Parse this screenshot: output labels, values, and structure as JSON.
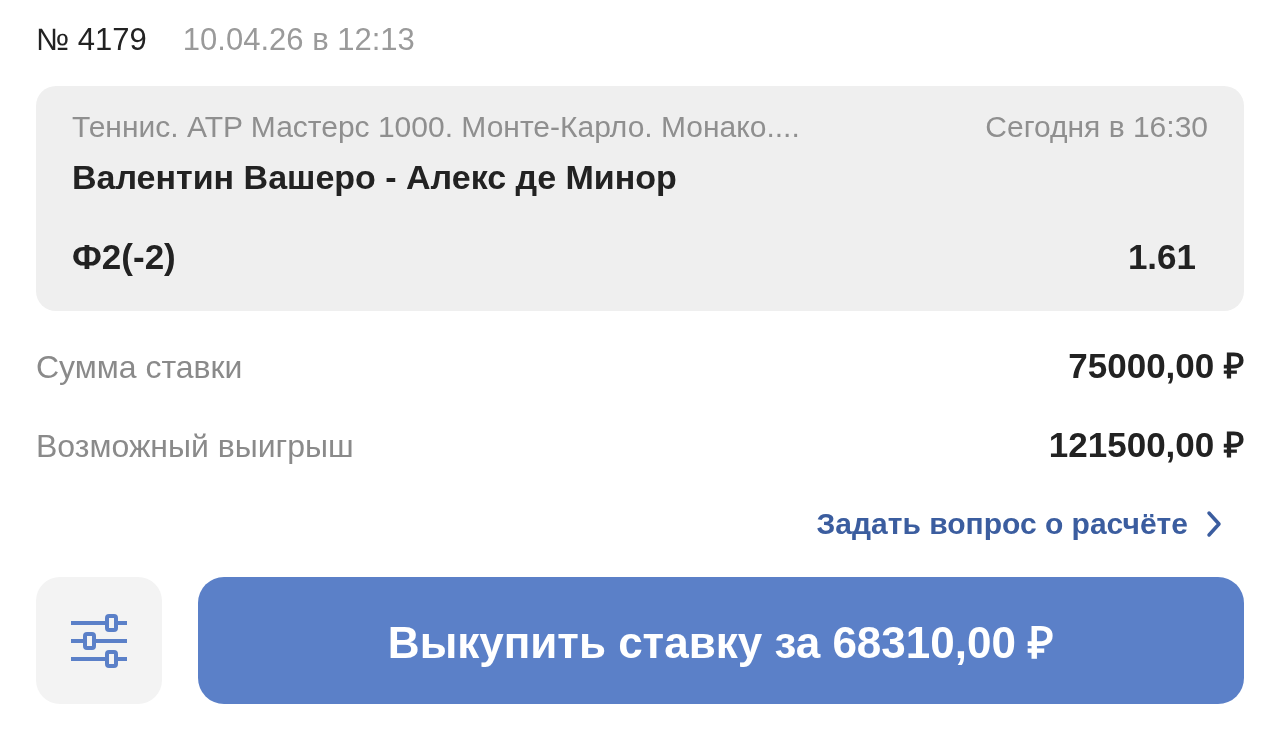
{
  "bet": {
    "number": "№ 4179",
    "date": "10.04.26 в 12:13"
  },
  "event": {
    "tournament": "Теннис. ATP Мастерс 1000. Монте-Карло. Монако....",
    "start": "Сегодня в 16:30",
    "match": "Валентин Вашеро - Алекс де Минор",
    "outcome": "Ф2(-2)",
    "odds": "1.61"
  },
  "summary": [
    {
      "label": "Сумма ставки",
      "value": "75000,00 ₽"
    },
    {
      "label": "Возможный выигрыш",
      "value": "121500,00 ₽"
    }
  ],
  "question_link": "Задать вопрос о расчёте",
  "cashout_button": "Выкупить ставку за 68310,00 ₽"
}
